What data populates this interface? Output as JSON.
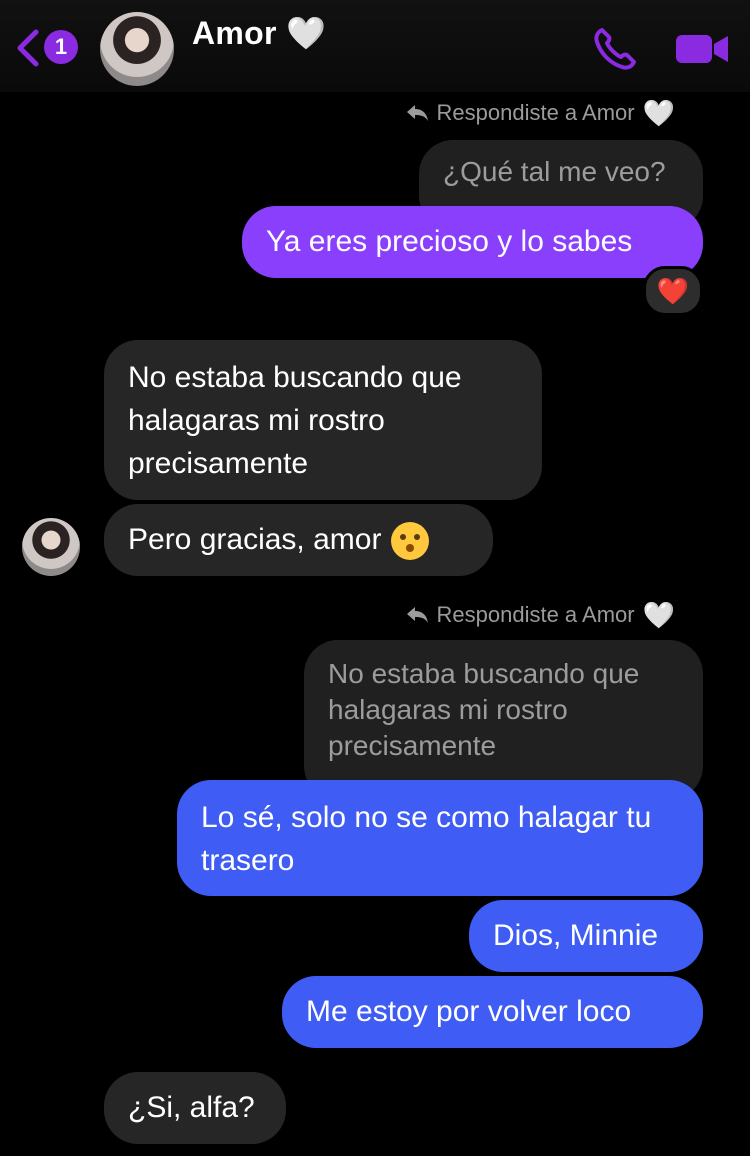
{
  "header": {
    "unread_count": "1",
    "contact_name": "Amor 🤍",
    "accent_color": "#8a2be2"
  },
  "messages": {
    "reply_note_1": "Respondiste a Amor",
    "quoted_1": "¿Qué tal me veo?",
    "sent_1": "Ya eres precioso y lo sabes",
    "reaction_1": "❤️",
    "received_1": "No estaba buscando que halagaras mi rostro precisamente",
    "received_2": "Pero gracias, amor",
    "reply_note_2": "Respondiste a Amor",
    "quoted_2": "No estaba buscando que halagaras mi rostro precisamente",
    "sent_2": "Lo sé, solo no se como halagar tu trasero",
    "sent_3": "Dios, Minnie",
    "sent_4": "Me estoy por volver loco",
    "received_3": "¿Si, alfa?"
  },
  "icons": {
    "back": "chevron-left-icon",
    "call": "phone-icon",
    "video": "video-camera-icon",
    "reply": "reply-arrow-icon",
    "heart": "white-heart-icon",
    "kiss": "kissing-face-icon"
  },
  "colors": {
    "sent_purple": "#8a3ffc",
    "sent_blue": "#3f5cf5",
    "received_gray": "#262626"
  }
}
